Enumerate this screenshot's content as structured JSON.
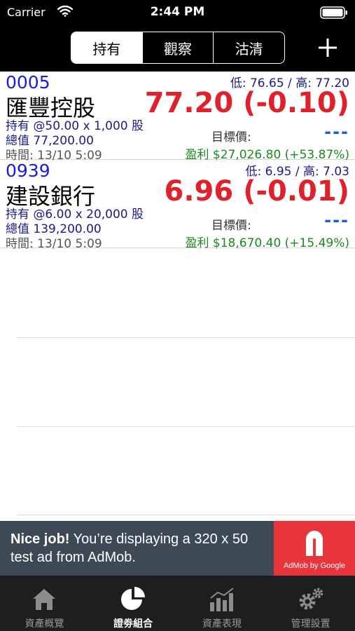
{
  "status": {
    "carrier": "Carrier",
    "time": "2:44 PM"
  },
  "segments": [
    {
      "label": "持有",
      "active": true
    },
    {
      "label": "觀察",
      "active": false
    },
    {
      "label": "沽清",
      "active": false
    }
  ],
  "stocks": [
    {
      "code": "0005",
      "range": "低: 76.65 / 高: 77.20",
      "name": "匯豐控股",
      "price": "77.20 (-0.10)",
      "holding": "持有 @50.00 x 1,000 股",
      "value": "總值 77,200.00",
      "time": "時間: 13/10 5:09",
      "target_label": "目標價:",
      "target_value": "---",
      "profit": "盈利 $27,026.80 (+53.87%)"
    },
    {
      "code": "0939",
      "range": "低: 6.95 / 高: 7.03",
      "name": "建設銀行",
      "price": "6.96 (-0.01)",
      "holding": "持有 @6.00 x 20,000 股",
      "value": "總值 139,200.00",
      "time": "時間: 13/10 5:09",
      "target_label": "目標價:",
      "target_value": "---",
      "profit": "盈利 $18,670.40 (+15.49%)"
    }
  ],
  "ad": {
    "headline": "Nice job!",
    "body": " You’re displaying a 320 x 50 test ad from AdMob.",
    "logo_caption": "AdMob by Google"
  },
  "tabs": [
    {
      "label": "資產概覽",
      "icon": "home-icon",
      "active": false
    },
    {
      "label": "證劵組合",
      "icon": "pie-chart-icon",
      "active": true
    },
    {
      "label": "資產表現",
      "icon": "bar-chart-icon",
      "active": false
    },
    {
      "label": "管理設置",
      "icon": "gear-icon",
      "active": false
    }
  ],
  "colors": {
    "price_down": "#e0202a",
    "code_blue": "#1a1ae6",
    "profit_green": "#1a8a1a",
    "ad_red": "#e8343a"
  }
}
